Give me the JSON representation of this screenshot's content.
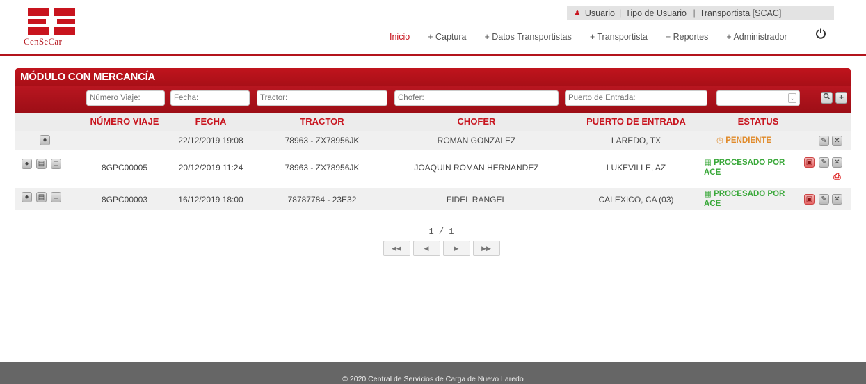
{
  "brand": {
    "logo_text": "CenSeCar",
    "accent": "#c8141e"
  },
  "userbar": {
    "user": "Usuario",
    "role_label": "Tipo de Usuario",
    "type": "Transportista [SCAC]"
  },
  "nav": {
    "items": [
      "Inicio",
      "+ Captura",
      "+ Datos Transportistas",
      "+ Transportista",
      "+ Reportes",
      "+ Administrador"
    ],
    "power_icon": "power-icon"
  },
  "module": {
    "title": "MÓDULO CON MERCANCÍA",
    "filters": {
      "numero_viaje": "Número Viaje:",
      "fecha": "Fecha:",
      "tractor": "Tractor:",
      "chofer": "Chofer:",
      "puerto": "Puerto de Entrada:",
      "estatus_selected": ""
    },
    "columns": [
      "NÚMERO VIAJE",
      "FECHA",
      "TRACTOR",
      "CHOFER",
      "PUERTO DE ENTRADA",
      "ESTATUS"
    ],
    "rows": [
      {
        "numero_viaje": "",
        "fecha": "22/12/2019 19:08",
        "tractor": "78963 - ZX78956JK",
        "chofer": "ROMAN GONZALEZ",
        "puerto": "LAREDO, TX",
        "estatus": "PENDIENTE"
      },
      {
        "numero_viaje": "8GPC00005",
        "fecha": "20/12/2019 11:24",
        "tractor": "78963 - ZX78956JK",
        "chofer": "JOAQUIN ROMAN HERNANDEZ",
        "puerto": "LUKEVILLE, AZ",
        "estatus": "PROCESADO POR ACE"
      },
      {
        "numero_viaje": "8GPC00003",
        "fecha": "16/12/2019 18:00",
        "tractor": "78787784 - 23E32",
        "chofer": "FIDEL RANGEL",
        "puerto": "CALEXICO, CA (03)",
        "estatus": "PROCESADO POR ACE"
      }
    ]
  },
  "pager": {
    "current": "1",
    "separator": "/",
    "total": "1"
  },
  "footer": {
    "text": "© 2020 Central de Servicios de Carga de Nuevo Laredo"
  }
}
